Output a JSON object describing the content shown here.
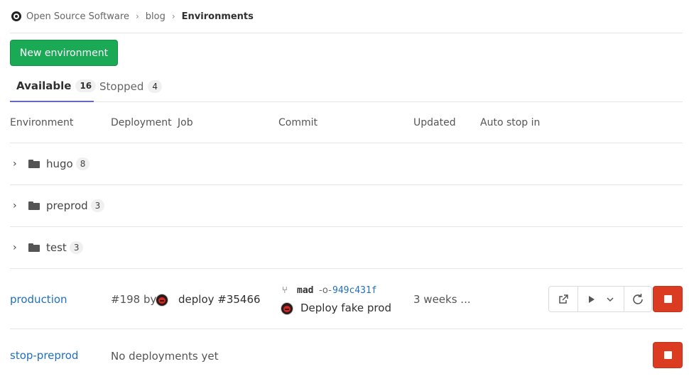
{
  "breadcrumb": {
    "items": [
      "Open Source Software",
      "blog"
    ],
    "current": "Environments",
    "separator": "›"
  },
  "new_environment_label": "New environment",
  "tabs": [
    {
      "label": "Available",
      "count": "16",
      "active": true
    },
    {
      "label": "Stopped",
      "count": "4",
      "active": false
    }
  ],
  "table": {
    "headers": [
      "Environment",
      "Deployment",
      "Job",
      "Commit",
      "Updated",
      "Auto stop in"
    ]
  },
  "folders": [
    {
      "name": "hugo",
      "count": "8"
    },
    {
      "name": "preprod",
      "count": "3"
    },
    {
      "name": "test",
      "count": "3"
    }
  ],
  "production": {
    "name": "production",
    "deployment": "#198 by",
    "job": "deploy #35466",
    "branch": "mad",
    "sha": "949c431f",
    "commit_title": "Deploy fake prod",
    "updated": "3 weeks ..."
  },
  "stop_preprod": {
    "name": "stop-preprod",
    "status": "No deployments yet"
  },
  "icons": {
    "chevron": "chevron-right-icon",
    "folder": "folder-icon",
    "branch": "branch-icon",
    "commit": "commit-icon",
    "external": "external-link-icon",
    "play": "play-icon",
    "dropdown": "chevron-down-icon",
    "rollback": "redeploy-icon",
    "stop": "stop-icon"
  },
  "colors": {
    "primary_green": "#1aaa55",
    "danger_red": "#db3b21",
    "link_blue": "#1f6fbf",
    "tab_underline": "#6666c4"
  }
}
